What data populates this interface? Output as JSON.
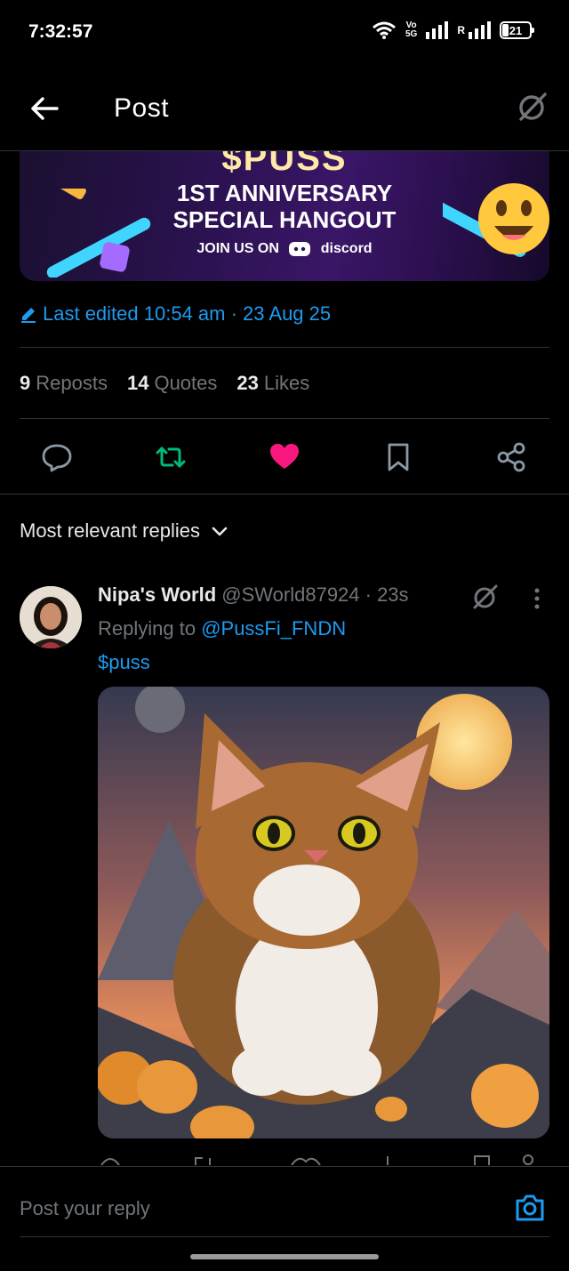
{
  "status_bar": {
    "time": "7:32:57",
    "network_top": "Vo",
    "network_bottom": "5G",
    "roaming": "R",
    "battery": "21"
  },
  "header": {
    "title": "Post",
    "back_icon": "arrow-left-icon",
    "grok_icon": "grok-icon"
  },
  "banner": {
    "line1": "$PUSS",
    "line2": "1ST ANNIVERSARY",
    "line3": "SPECIAL HANGOUT",
    "join_text": "JOIN US ON",
    "platform": "discord"
  },
  "post_meta": {
    "edited_text": "Last edited 10:54 am · 23 Aug 25"
  },
  "stats": {
    "reposts_count": "9",
    "reposts_label": "Reposts",
    "quotes_count": "14",
    "quotes_label": "Quotes",
    "likes_count": "23",
    "likes_label": "Likes"
  },
  "actions": {
    "reply_icon": "comment-icon",
    "repost_icon": "repost-icon",
    "like_icon": "heart-icon",
    "bookmark_icon": "bookmark-icon",
    "share_icon": "share-icon",
    "repost_color": "#00ba7c",
    "like_color": "#f91880"
  },
  "replies": {
    "sort_label": "Most relevant replies",
    "items": [
      {
        "name": "Nipa's World",
        "handle_time": " @SWorld87924 · 23s",
        "replying_prefix": "Replying to ",
        "replying_to": "@PussFi_FNDN",
        "text": "$puss"
      }
    ]
  },
  "composer": {
    "placeholder": "Post your reply",
    "camera_icon": "camera-icon"
  },
  "colors": {
    "accent": "#1d9bf0",
    "background": "#000000",
    "secondary_text": "#71767b",
    "divider": "#2f3336"
  }
}
